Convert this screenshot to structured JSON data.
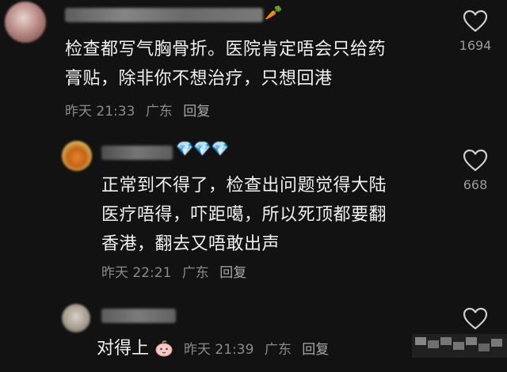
{
  "comments": [
    {
      "text": "检查都写气胸骨折。医院肯定唔会只给药\n膏贴，除非你不想治疗，只想回港",
      "time": "昨天 21:33",
      "location": "广东",
      "reply_label": "回复",
      "likes": "1694",
      "username_emoji": "🥕"
    },
    {
      "text": "正常到不得了，检查出问题觉得大陆\n医疗唔得，吓距噶，所以死顶都要翻\n香港，翻去又唔敢出声",
      "time": "昨天 22:21",
      "location": "广东",
      "reply_label": "回复",
      "likes": "668",
      "username_emoji": "💎💎💎"
    },
    {
      "text": "对得上",
      "time": "昨天 21:39",
      "location": "广东",
      "reply_label": "回复",
      "likes": ""
    }
  ],
  "colors": {
    "background": "#121212",
    "text": "#f0f0f0",
    "meta": "#8a8a8a",
    "icon": "#cfcfcf"
  }
}
